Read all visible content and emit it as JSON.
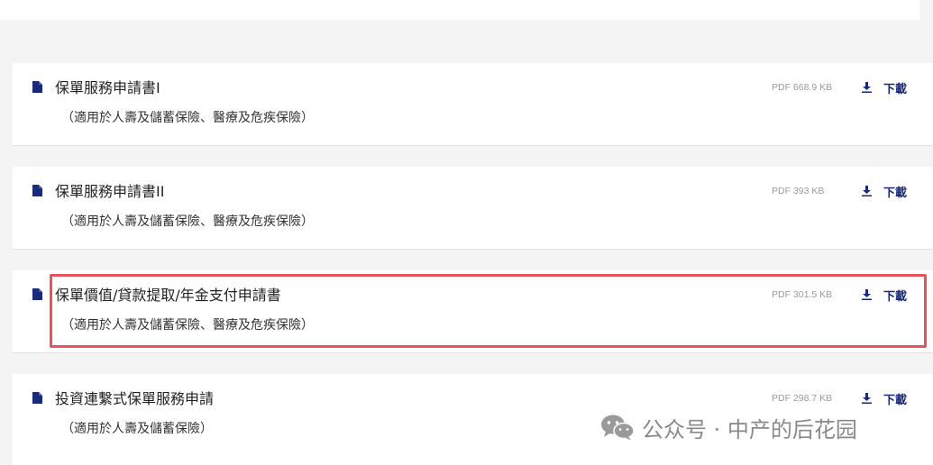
{
  "colors": {
    "page_background": "#f4f4f4",
    "card_background": "#ffffff",
    "icon_navy": "#1a2a7a",
    "highlight_border": "#e8525a",
    "meta_gray": "#9a9a9a"
  },
  "documents": [
    {
      "title": "保單服務申請書I",
      "subtitle": "（適用於人壽及儲蓄保險、醫療及危疾保險）",
      "meta": "PDF 668.9 KB",
      "download_label": "下載",
      "icon": "document-icon",
      "highlighted": false
    },
    {
      "title": "保單服務申請書II",
      "subtitle": "（適用於人壽及儲蓄保險、醫療及危疾保險）",
      "meta": "PDF 393 KB",
      "download_label": "下載",
      "icon": "document-icon",
      "highlighted": false
    },
    {
      "title": "保單價值/貸款提取/年金支付申請書",
      "subtitle": "（適用於人壽及儲蓄保險、醫療及危疾保險）",
      "meta": "PDF 301.5 KB",
      "download_label": "下載",
      "icon": "document-icon",
      "highlighted": true
    },
    {
      "title": "投資連繫式保單服務申請",
      "subtitle": "（適用於人壽及儲蓄保險）",
      "meta": "PDF 298.7 KB",
      "download_label": "下載",
      "icon": "document-icon",
      "highlighted": false
    }
  ],
  "watermark": {
    "text": "公众号 · 中产的后花园",
    "icon": "wechat-icon"
  }
}
